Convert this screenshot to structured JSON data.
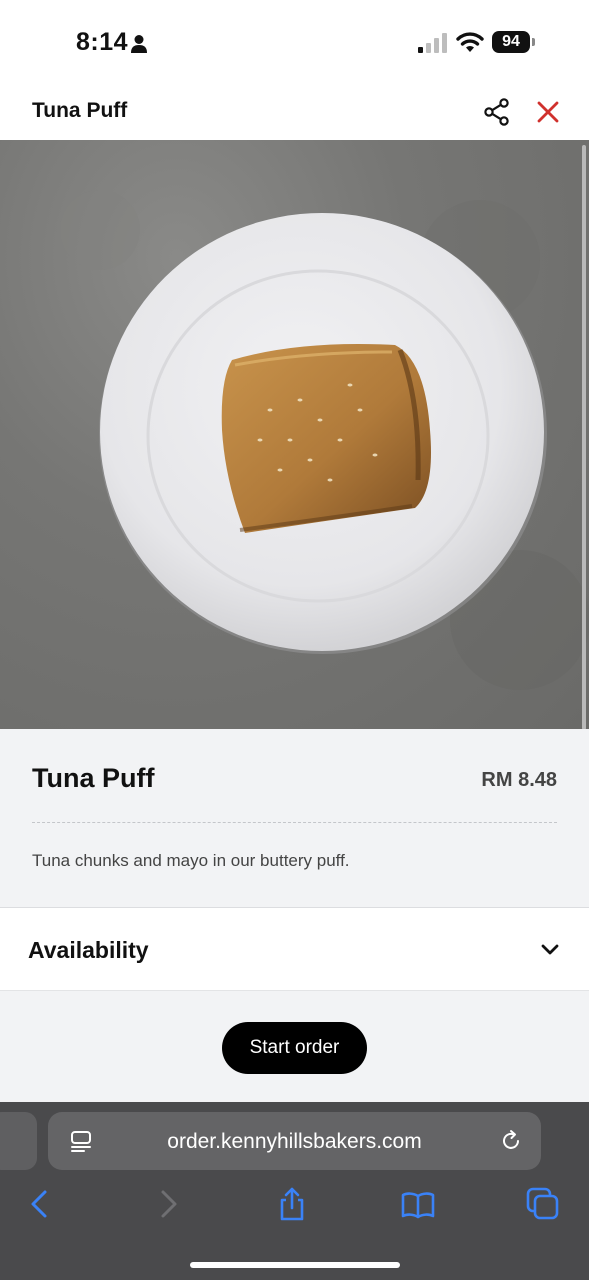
{
  "status_bar": {
    "time": "8:14",
    "battery": "94"
  },
  "header": {
    "title": "Tuna Puff"
  },
  "product": {
    "name": "Tuna Puff",
    "price": "RM 8.48",
    "description": "Tuna chunks and mayo in our buttery puff."
  },
  "availability": {
    "label": "Availability"
  },
  "actions": {
    "start_order": "Start order"
  },
  "browser": {
    "url": "order.kennyhillsbakers.com"
  },
  "colors": {
    "accent_close": "#d0312d",
    "safari_blue": "#3a82f7",
    "button_bg": "#000000"
  }
}
